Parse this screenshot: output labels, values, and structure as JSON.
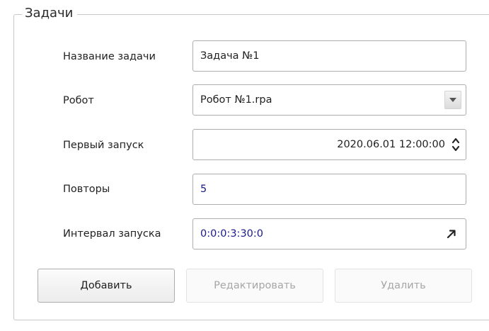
{
  "group": {
    "title": "Задачи"
  },
  "fields": {
    "task_name": {
      "label": "Название задачи",
      "value": "Задача №1"
    },
    "robot": {
      "label": "Робот",
      "value": "Робот №1.rpa"
    },
    "first_run": {
      "label": "Первый запуск",
      "value": "2020.06.01 12:00:00"
    },
    "repeats": {
      "label": "Повторы",
      "value": "5"
    },
    "interval": {
      "label": "Интервал запуска",
      "value": "0:0:0:3:30:0"
    }
  },
  "buttons": {
    "add": "Добавить",
    "edit": "Редактировать",
    "delete": "Удалить"
  },
  "icons": {
    "dropdown": "triangle-down-icon",
    "spinner": "up-down-chevron-icon",
    "expand": "diagonal-arrow-icon"
  },
  "colors": {
    "value_blue": "#1a1a8c",
    "disabled_text": "#a6a6a6",
    "border": "#adadad"
  }
}
